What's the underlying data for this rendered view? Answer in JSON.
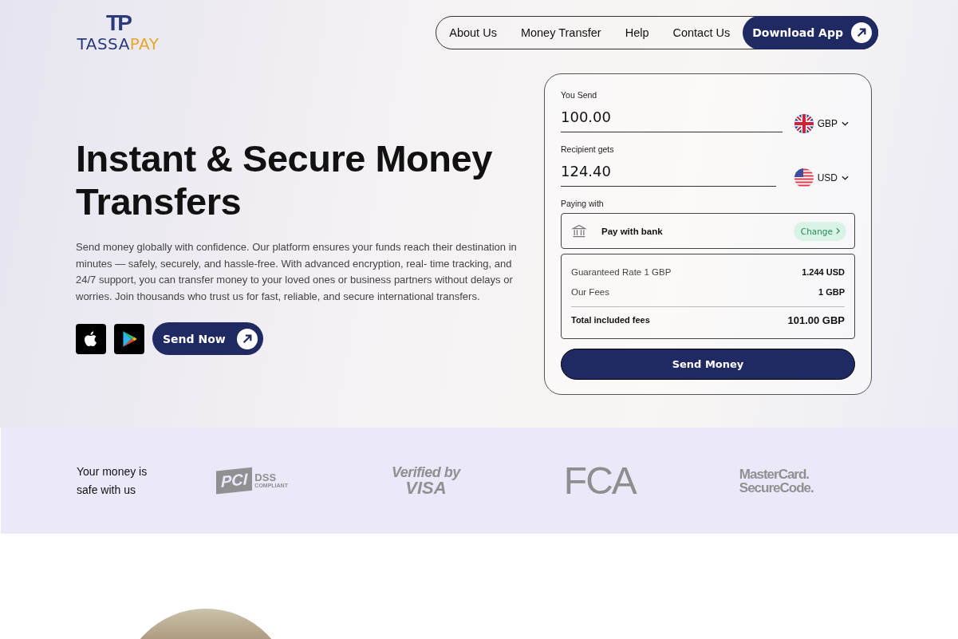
{
  "logo": {
    "mark": "TP",
    "name_left": "TASSA",
    "name_right": "PAY"
  },
  "nav": {
    "links": [
      {
        "label": "About Us"
      },
      {
        "label": "Money Transfer"
      },
      {
        "label": "Help"
      },
      {
        "label": "Contact Us"
      }
    ],
    "cta": "Download App"
  },
  "hero": {
    "title": "Instant & Secure Money Transfers",
    "text": "Send money globally with confidence. Our platform ensures your funds reach their destination in minutes — safely, securely, and hassle-free. With advanced encryption, real- time tracking, and 24/7 support, you can transfer money to your loved ones or business partners without delays or worries. Join thousands who trust us for fast, reliable, and secure international transfers.",
    "button": "Send Now"
  },
  "converter": {
    "fields": [
      {
        "label": "You Send",
        "value": "100.00",
        "currency": "GBP",
        "kind": "uk"
      },
      {
        "label": "Recipient gets",
        "value": "124.40",
        "currency": "USD",
        "kind": "us"
      }
    ],
    "paying_label": "Paying with",
    "method": "Pay with bank",
    "change": "Change",
    "summary": [
      {
        "label": "Guaranteed Rate 1 GBP",
        "value": "1.244 USD"
      },
      {
        "label": "Our Fees",
        "value": "1 GBP"
      }
    ],
    "total": {
      "label": "Total included fees",
      "value": "101.00 GBP"
    },
    "button": "Send Money"
  },
  "trust": {
    "title": "Your money is safe with us",
    "logos": [
      {
        "kind": "pci",
        "texts": [
          "PCI",
          "DSS",
          "COMPLIANT"
        ]
      },
      {
        "kind": "visa",
        "texts": [
          "Verified by",
          "VISA"
        ]
      },
      {
        "kind": "fca",
        "texts": [
          "FCA"
        ]
      },
      {
        "kind": "mastercard",
        "texts": [
          "MasterCard.",
          "SecureCode."
        ]
      }
    ]
  }
}
